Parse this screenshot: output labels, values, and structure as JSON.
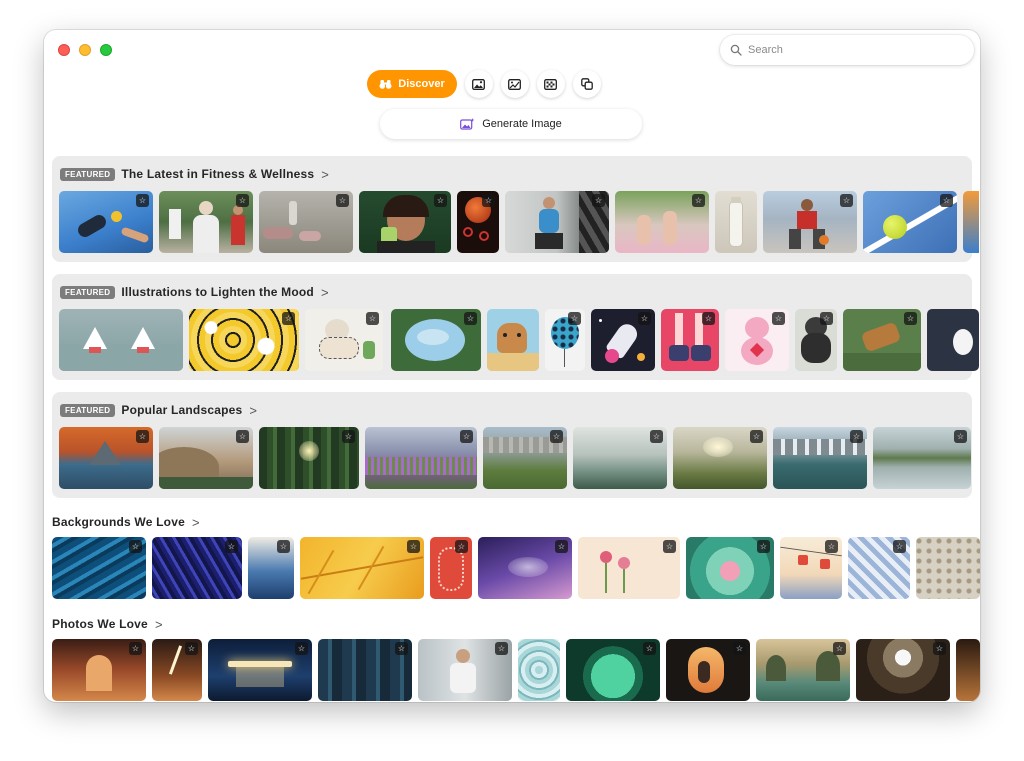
{
  "search": {
    "placeholder": "Search"
  },
  "tabs": {
    "discover_label": "Discover"
  },
  "generate": {
    "label": "Generate Image"
  },
  "sections": [
    {
      "featured": true,
      "badge": "FEATURED",
      "title": "The Latest in Fitness & Wellness",
      "chevron": ">"
    },
    {
      "featured": true,
      "badge": "FEATURED",
      "title": "Illustrations to Lighten the Mood",
      "chevron": ">"
    },
    {
      "featured": true,
      "badge": "FEATURED",
      "title": "Popular Landscapes",
      "chevron": ">"
    },
    {
      "featured": false,
      "title": "Backgrounds We Love",
      "chevron": ">"
    },
    {
      "featured": false,
      "title": "Photos We Love",
      "chevron": ">"
    }
  ],
  "icons": {
    "discover": "binoculars-icon",
    "tab2": "photo-icon",
    "tab3": "image-edit-icon",
    "tab4": "pattern-icon",
    "tab5": "copy-icon",
    "generate": "image-sparkle-icon",
    "favorite": "star-badge-icon"
  },
  "colors": {
    "accent": "#ff9500"
  }
}
